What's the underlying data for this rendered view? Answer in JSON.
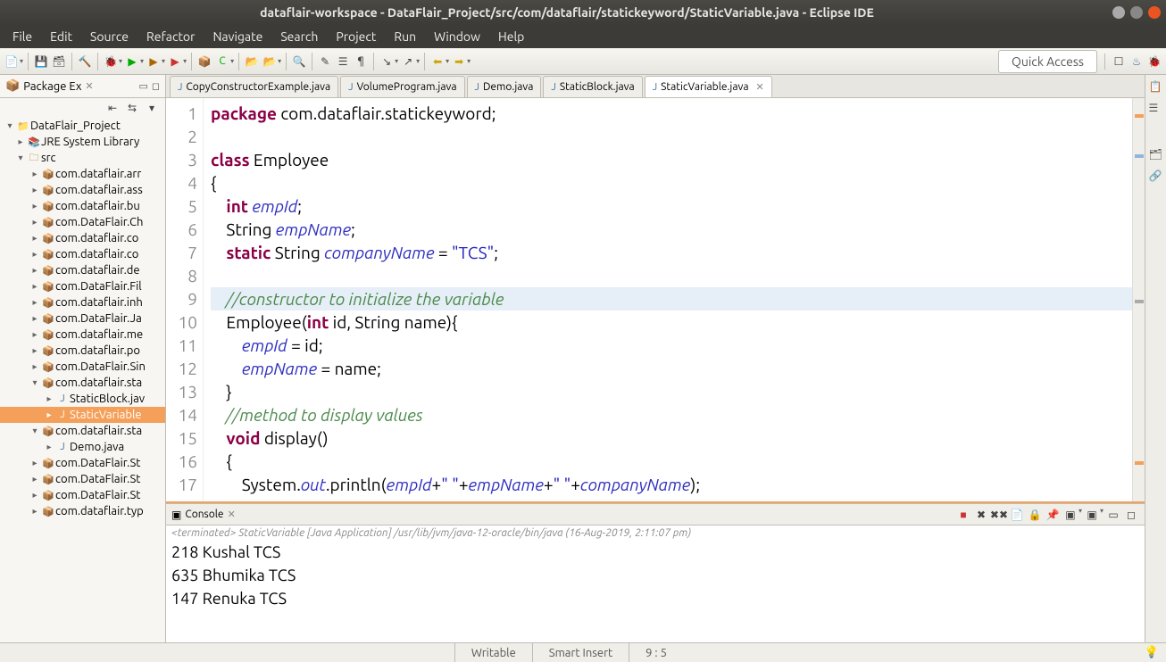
{
  "window": {
    "title": "dataflair-workspace - DataFlair_Project/src/com/dataflair/statickeyword/StaticVariable.java - Eclipse IDE"
  },
  "menu": [
    "File",
    "Edit",
    "Source",
    "Refactor",
    "Navigate",
    "Search",
    "Project",
    "Run",
    "Window",
    "Help"
  ],
  "quick_access": "Quick Access",
  "package_explorer": {
    "title": "Package Ex",
    "project": "DataFlair_Project",
    "jre": "JRE System Library",
    "src": "src",
    "packages": [
      "com.dataflair.arr",
      "com.dataflair.ass",
      "com.dataflair.bu",
      "com.DataFlair.Ch",
      "com.dataflair.co",
      "com.dataflair.co",
      "com.dataflair.de",
      "com.DataFlair.Fil",
      "com.dataflair.inh",
      "com.DataFlair.Ja",
      "com.dataflair.me",
      "com.dataflair.po",
      "com.DataFlair.Sin"
    ],
    "open_package": "com.dataflair.sta",
    "open_files": [
      "StaticBlock.jav",
      "StaticVariable"
    ],
    "open_package2": "com.dataflair.sta",
    "demo_file": "Demo.java",
    "tail_packages": [
      "com.DataFlair.St",
      "com.DataFlair.St",
      "com.DataFlair.St",
      "com.dataflair.typ"
    ]
  },
  "editor": {
    "tabs": [
      {
        "label": "CopyConstructorExample.java",
        "active": false
      },
      {
        "label": "VolumeProgram.java",
        "active": false
      },
      {
        "label": "Demo.java",
        "active": false
      },
      {
        "label": "StaticBlock.java",
        "active": false
      },
      {
        "label": "StaticVariable.java",
        "active": true
      }
    ],
    "code_lines": [
      {
        "n": "1",
        "html": "<span class='kw'>package</span> com.dataflair.statickeyword;"
      },
      {
        "n": "2",
        "html": ""
      },
      {
        "n": "3",
        "html": "<span class='kw'>class</span> Employee"
      },
      {
        "n": "4",
        "html": "{"
      },
      {
        "n": "5",
        "html": "    <span class='kw'>int</span> <span class='fld'>empId</span>;"
      },
      {
        "n": "6",
        "html": "    String <span class='fld'>empName</span>;"
      },
      {
        "n": "7",
        "html": "    <span class='kw'>static</span> String <span class='fld'>companyName</span> = <span class='str'>\"TCS\"</span>;"
      },
      {
        "n": "8",
        "html": ""
      },
      {
        "n": "9",
        "html": "    <span class='cm'>//constructor to initialize the variable</span>",
        "hl": true
      },
      {
        "n": "10",
        "html": "    Employee(<span class='kw'>int</span> id, String name){"
      },
      {
        "n": "11",
        "html": "        <span class='fld'>empId</span> = id;"
      },
      {
        "n": "12",
        "html": "        <span class='fld'>empName</span> = name;"
      },
      {
        "n": "13",
        "html": "    }"
      },
      {
        "n": "14",
        "html": "    <span class='cm'>//method to display values</span>"
      },
      {
        "n": "15",
        "html": "    <span class='kw'>void</span> display()"
      },
      {
        "n": "16",
        "html": "    {"
      },
      {
        "n": "17",
        "html": "        System.<span class='fld'>out</span>.println(<span class='fld'>empId</span>+<span class='str'>\" \"</span>+<span class='fld'>empName</span>+<span class='str'>\" \"</span>+<span class='fld'>companyName</span>);"
      }
    ]
  },
  "console": {
    "title": "Console",
    "info": "<terminated> StaticVariable [Java Application] /usr/lib/jvm/java-12-oracle/bin/java (16-Aug-2019, 2:11:07 pm)",
    "lines": [
      "218 Kushal TCS",
      "635 Bhumika TCS",
      "147 Renuka TCS"
    ]
  },
  "status": {
    "writable": "Writable",
    "mode": "Smart Insert",
    "pos": "9 : 5"
  }
}
